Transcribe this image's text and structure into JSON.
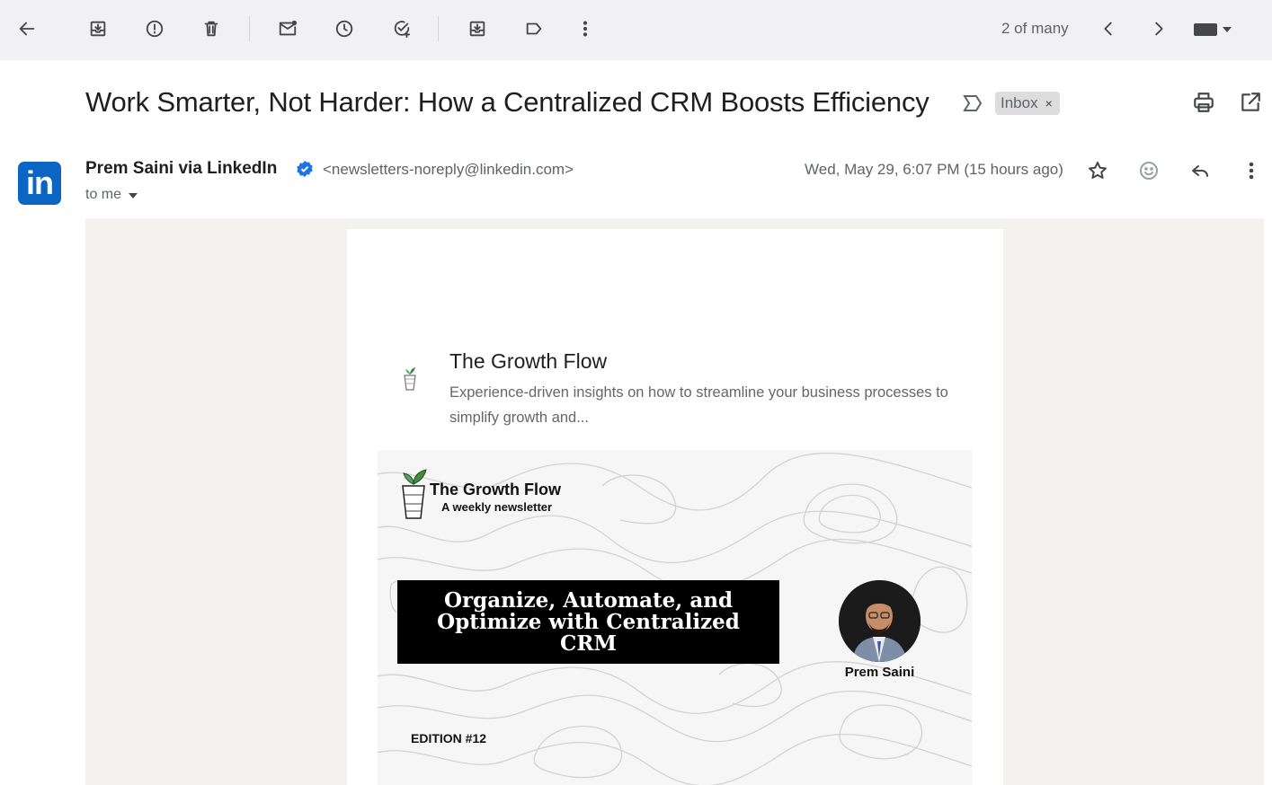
{
  "toolbar": {
    "pager_text": "2 of many",
    "icons": [
      "back-arrow-icon",
      "archive-icon",
      "report-spam-icon",
      "delete-icon",
      "mark-unread-icon",
      "snooze-icon",
      "add-task-icon",
      "move-to-icon",
      "label-icon",
      "more-vert-icon",
      "prev-icon",
      "next-icon",
      "keyboard-icon"
    ]
  },
  "subject": "Work Smarter, Not Harder: How a Centralized CRM Boosts Efficiency",
  "label": "Inbox",
  "label_remove": "×",
  "sender": {
    "logo_text": "in",
    "name": "Prem Saini via LinkedIn",
    "email": "<newsletters-noreply@linkedin.com>",
    "to": "to me",
    "date": "Wed, May 29, 6:07 PM (15 hours ago)"
  },
  "newsletter": {
    "title": "The Growth Flow",
    "description": "Experience-driven insights on how to streamline your business processes to simplify growth and..."
  },
  "banner": {
    "logo_title": "The Growth Flow",
    "logo_subtitle": "A weekly newsletter",
    "headline": "Organize, Automate, and Optimize with Centralized CRM",
    "author": "Prem Saini",
    "edition": "EDITION #12"
  },
  "colors": {
    "toolbar_bg": "#f1f1f3",
    "linkedin_blue": "#0a66c2",
    "verified_blue": "#1a73e8",
    "mail_bg": "#f3f2ef"
  }
}
